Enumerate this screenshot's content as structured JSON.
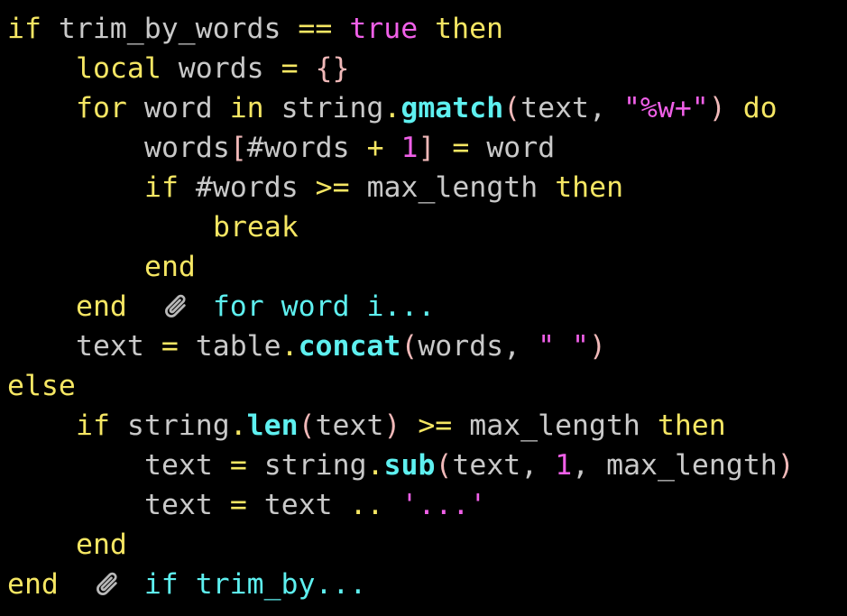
{
  "code": {
    "lines": [
      [
        "if",
        "trim_by_words",
        "==",
        "true",
        "then"
      ],
      [
        "local",
        "words",
        "=",
        "{}"
      ],
      [
        "for",
        "word",
        "in",
        "string",
        ".",
        "gmatch",
        "(",
        "text",
        ",",
        "\"%w+\"",
        ")",
        "do"
      ],
      [
        "words",
        "[",
        "#words",
        "+",
        "1",
        "]",
        "=",
        "word"
      ],
      [
        "if",
        "#words",
        ">=",
        "max_length",
        "then"
      ],
      [
        "break"
      ],
      [
        "end"
      ],
      [
        "end"
      ],
      [
        "text",
        "=",
        "table",
        ".",
        "concat",
        "(",
        "words",
        ",",
        "\" \"",
        ")"
      ],
      [
        "else"
      ],
      [
        "if",
        "string",
        ".",
        "len",
        "(",
        "text",
        ")",
        ">=",
        "max_length",
        "then"
      ],
      [
        "text",
        "=",
        "string",
        ".",
        "sub",
        "(",
        "text",
        ",",
        "1",
        ",",
        "max_length",
        ")"
      ],
      [
        "text",
        "=",
        "text",
        "..",
        "'...'"
      ],
      [
        "end"
      ],
      [
        "end"
      ]
    ],
    "fold_markers": [
      {
        "line": 8,
        "summary": "for word i..."
      },
      {
        "line": 15,
        "summary": "if trim_by..."
      }
    ]
  },
  "colors": {
    "background": "#000000",
    "keyword": "#f5e663",
    "identifier": "#c9c9c9",
    "literal": "#f060e8",
    "function": "#5ef0f0",
    "bracket": "#f0b8b8",
    "fold_summary": "#5ef0f0"
  },
  "icons": {
    "fold_marker": "paperclip-icon"
  }
}
